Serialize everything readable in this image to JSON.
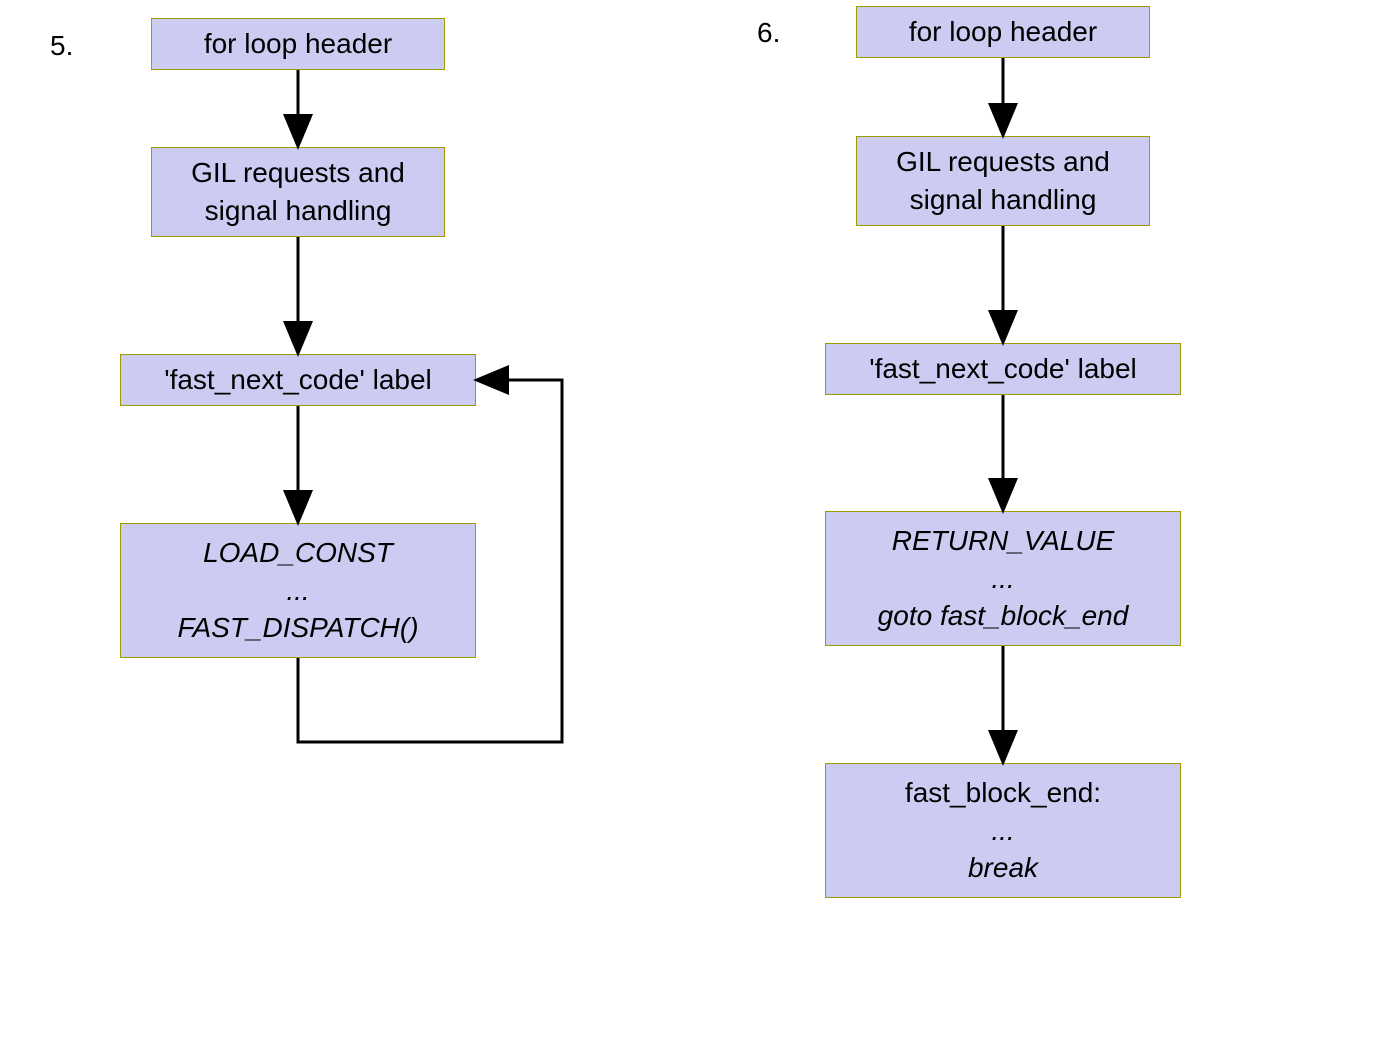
{
  "labels": {
    "left_num": "5.",
    "right_num": "6."
  },
  "left": {
    "box1": "for loop header",
    "box2_l1": "GIL requests and",
    "box2_l2": "signal handling",
    "box3": "'fast_next_code' label",
    "box4_l1": "LOAD_CONST",
    "box4_l2": "...",
    "box4_l3": "FAST_DISPATCH()"
  },
  "right": {
    "box1": "for loop header",
    "box2_l1": "GIL requests and",
    "box2_l2": "signal handling",
    "box3": "'fast_next_code' label",
    "box4_l1": "RETURN_VALUE",
    "box4_l2": "...",
    "box4_l3": "goto fast_block_end",
    "box5_l1": "fast_block_end:",
    "box5_l2": "...",
    "box5_l3": "break"
  },
  "chart_data": {
    "type": "diagram",
    "flowcharts": [
      {
        "label": "5.",
        "nodes": [
          {
            "id": "L1",
            "text": "for loop header"
          },
          {
            "id": "L2",
            "text": "GIL requests and signal handling"
          },
          {
            "id": "L3",
            "text": "'fast_next_code' label"
          },
          {
            "id": "L4",
            "text": "LOAD_CONST ... FAST_DISPATCH()",
            "italic": true
          }
        ],
        "edges": [
          {
            "from": "L1",
            "to": "L2"
          },
          {
            "from": "L2",
            "to": "L3"
          },
          {
            "from": "L3",
            "to": "L4"
          },
          {
            "from": "L4",
            "to": "L3",
            "loop_back": true
          }
        ]
      },
      {
        "label": "6.",
        "nodes": [
          {
            "id": "R1",
            "text": "for loop header"
          },
          {
            "id": "R2",
            "text": "GIL requests and signal handling"
          },
          {
            "id": "R3",
            "text": "'fast_next_code' label"
          },
          {
            "id": "R4",
            "text": "RETURN_VALUE ... goto fast_block_end",
            "italic": true
          },
          {
            "id": "R5",
            "text": "fast_block_end: ... break",
            "partial_italic": true
          }
        ],
        "edges": [
          {
            "from": "R1",
            "to": "R2"
          },
          {
            "from": "R2",
            "to": "R3"
          },
          {
            "from": "R3",
            "to": "R4"
          },
          {
            "from": "R4",
            "to": "R5"
          }
        ]
      }
    ]
  }
}
